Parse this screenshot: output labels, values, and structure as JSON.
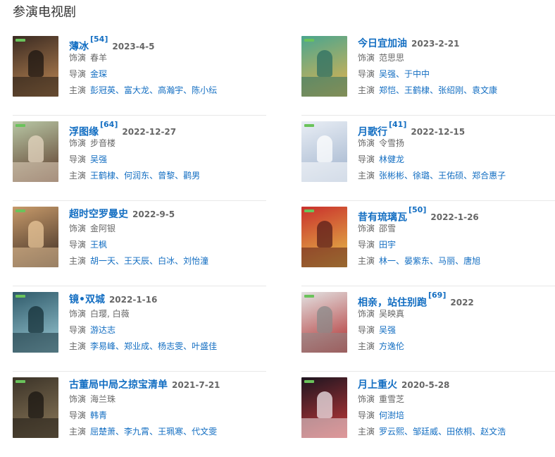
{
  "section": {
    "title": "参演电视剧"
  },
  "labels": {
    "role": "饰演",
    "director": "导演",
    "starring": "主演"
  },
  "dramas": [
    {
      "title": "薄冰",
      "ref": "[54]",
      "date": "2023-4-5",
      "role": "春羊",
      "directors": [
        "金琛"
      ],
      "starring": [
        "彭冠英",
        "富大龙",
        "高瀚宇",
        "陈小纭"
      ],
      "colors": [
        "#3a2a22",
        "#c08a55",
        "#1c1512"
      ]
    },
    {
      "title": "今日宜加油",
      "ref": "",
      "date": "2023-2-21",
      "role": "范思思",
      "directors": [
        "吴强",
        "于中中"
      ],
      "starring": [
        "郑恺",
        "王鹤棣",
        "张绍刚",
        "袁文康"
      ],
      "colors": [
        "#4aa58f",
        "#e8b34a",
        "#2d6f63"
      ]
    },
    {
      "title": "浮图缘",
      "ref": "[64]",
      "date": "2022-12-27",
      "role": "步音楼",
      "directors": [
        "吴强"
      ],
      "starring": [
        "王鹤棣",
        "何润东",
        "曾黎",
        "鹳男"
      ],
      "colors": [
        "#b8c7a5",
        "#5c3a2a",
        "#e6d7c2"
      ]
    },
    {
      "title": "月歌行",
      "ref": "[41]",
      "date": "2022-12-15",
      "role": "令雪扬",
      "directors": [
        "林健龙"
      ],
      "starring": [
        "张彬彬",
        "徐璐",
        "王佑硕",
        "郑合惠子"
      ],
      "colors": [
        "#e9eef5",
        "#9fb2cc",
        "#ffffff"
      ]
    },
    {
      "title": "超时空罗曼史",
      "ref": "",
      "date": "2022-9-5",
      "role": "金阿银",
      "directors": [
        "王枫"
      ],
      "starring": [
        "胡一天",
        "王天辰",
        "白冰",
        "刘怡潼"
      ],
      "colors": [
        "#c79a6a",
        "#3b2c24",
        "#e9c79a"
      ]
    },
    {
      "title": "昔有琉璃瓦",
      "ref": "[50]",
      "date": "2022-1-26",
      "role": "邵雪",
      "directors": [
        "田宇"
      ],
      "starring": [
        "林一",
        "晏紫东",
        "马丽",
        "唐旭"
      ],
      "colors": [
        "#c9302c",
        "#e6c24a",
        "#5a1f1b"
      ]
    },
    {
      "title": "镜•双城",
      "ref": "",
      "date": "2022-1-16",
      "role": "白璎, 白薇",
      "directors": [
        "游达志"
      ],
      "starring": [
        "李易峰",
        "郑业成",
        "杨志雯",
        "叶盛佳"
      ],
      "colors": [
        "#2f5a6a",
        "#9ccbd6",
        "#163038"
      ]
    },
    {
      "title": "相亲，站住别跑",
      "ref": "[69]",
      "date": "2022",
      "role": "吴映真",
      "directors": [
        "吴强"
      ],
      "starring": [
        "方逸伦"
      ],
      "colors": [
        "#e2e2e2",
        "#b02a2a",
        "#8a8a8a"
      ]
    },
    {
      "title": "古董局中局之掠宝清单",
      "ref": "",
      "date": "2021-7-21",
      "role": "海兰珠",
      "directors": [
        "韩青"
      ],
      "starring": [
        "屈楚萧",
        "李九霄",
        "王珮寒",
        "代文雯"
      ],
      "colors": [
        "#3b3328",
        "#8d7a5a",
        "#1a1612"
      ]
    },
    {
      "title": "月上重火",
      "ref": "",
      "date": "2020-5-28",
      "role": "重雪芝",
      "directors": [
        "何澍培"
      ],
      "starring": [
        "罗云熙",
        "邹廷威",
        "田依桐",
        "赵文浩"
      ],
      "colors": [
        "#1d1520",
        "#c83a3a",
        "#f0e6ea"
      ]
    }
  ]
}
